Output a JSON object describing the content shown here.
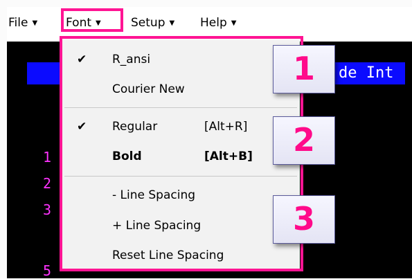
{
  "menubar": {
    "items": [
      {
        "label": "File"
      },
      {
        "label": "Font"
      },
      {
        "label": "Setup"
      },
      {
        "label": "Help"
      }
    ],
    "arrow_glyph": "▼"
  },
  "terminal": {
    "header_text": "de Int",
    "line_numbers": [
      "1",
      "2",
      "3",
      "5"
    ]
  },
  "font_menu": {
    "check_glyph": "✔",
    "fonts": [
      {
        "label": "R_ansi",
        "checked": true
      },
      {
        "label": "Courier New",
        "checked": false
      }
    ],
    "styles": [
      {
        "label": "Regular",
        "shortcut": "[Alt+R]",
        "checked": true,
        "bold": false
      },
      {
        "label": "Bold",
        "shortcut": "[Alt+B]",
        "checked": false,
        "bold": true
      }
    ],
    "spacing": [
      {
        "label": "- Line Spacing"
      },
      {
        "label": "+ Line Spacing"
      },
      {
        "label": "Reset Line Spacing"
      }
    ]
  },
  "callouts": [
    "1",
    "2",
    "3"
  ],
  "colors": {
    "highlight": "#ff1493",
    "terminal_bg": "#000000",
    "header_bar": "#0b0bff",
    "line_number": "#ff33ff"
  }
}
